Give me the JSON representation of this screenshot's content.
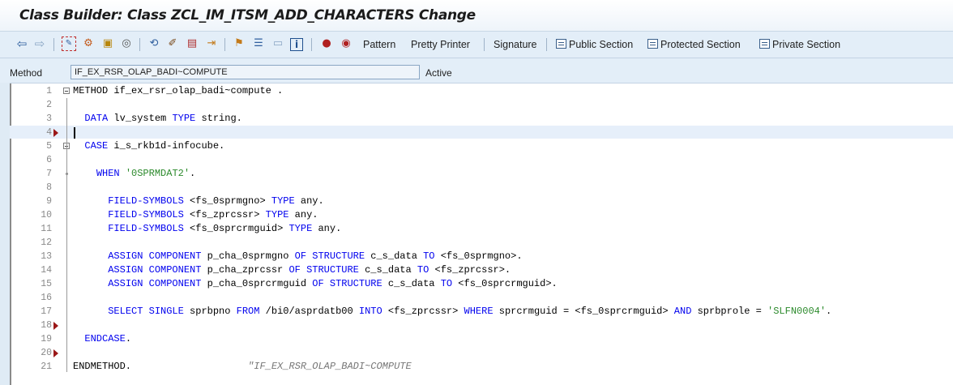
{
  "window": {
    "title": "Class Builder: Class ZCL_IM_ITSM_ADD_CHARACTERS Change"
  },
  "toolbar": {
    "icons": [
      "back-arrow-icon",
      "forward-arrow-icon",
      "display-change-icon",
      "other-object-icon",
      "activate-icon",
      "check-icon",
      "where-used-icon",
      "hierarchy-icon",
      "edit-icon",
      "display-object-list-icon",
      "navigate-icon",
      "tree-icon",
      "indent-icon",
      "frame-icon",
      "info-icon",
      "breakpoint-icon",
      "session-breakpoint-icon"
    ],
    "pattern": "Pattern",
    "pretty_printer": "Pretty Printer",
    "signature": "Signature",
    "public_section": "Public Section",
    "protected_section": "Protected Section",
    "private_section": "Private Section"
  },
  "method_row": {
    "label": "Method",
    "value": "IF_EX_RSR_OLAP_BADI~COMPUTE",
    "status": "Active"
  },
  "editor": {
    "lines": [
      {
        "num": "1",
        "breakpoint": false,
        "parts": [
          {
            "t": "METHOD",
            "c": ""
          },
          {
            "t": " if_ex_rsr_olap_badi~compute .",
            "c": ""
          }
        ]
      },
      {
        "num": "2",
        "breakpoint": false,
        "parts": []
      },
      {
        "num": "3",
        "breakpoint": false,
        "parts": [
          {
            "t": "  ",
            "c": ""
          },
          {
            "t": "DATA",
            "c": "kw"
          },
          {
            "t": " lv_system ",
            "c": ""
          },
          {
            "t": "TYPE",
            "c": "kw"
          },
          {
            "t": " string.",
            "c": ""
          }
        ]
      },
      {
        "num": "4",
        "breakpoint": true,
        "parts": []
      },
      {
        "num": "5",
        "breakpoint": false,
        "parts": [
          {
            "t": "  ",
            "c": ""
          },
          {
            "t": "CASE",
            "c": "kw"
          },
          {
            "t": " i_s_rkb1d-infocube.",
            "c": ""
          }
        ]
      },
      {
        "num": "6",
        "breakpoint": false,
        "parts": []
      },
      {
        "num": "7",
        "breakpoint": false,
        "parts": [
          {
            "t": "    ",
            "c": ""
          },
          {
            "t": "WHEN",
            "c": "kw"
          },
          {
            "t": " ",
            "c": ""
          },
          {
            "t": "'0SPRMDAT2'",
            "c": "str"
          },
          {
            "t": ".",
            "c": ""
          }
        ]
      },
      {
        "num": "8",
        "breakpoint": false,
        "parts": []
      },
      {
        "num": "9",
        "breakpoint": false,
        "parts": [
          {
            "t": "      ",
            "c": ""
          },
          {
            "t": "FIELD-SYMBOLS",
            "c": "kw"
          },
          {
            "t": " <fs_0sprmgno> ",
            "c": ""
          },
          {
            "t": "TYPE",
            "c": "kw"
          },
          {
            "t": " any.",
            "c": ""
          }
        ]
      },
      {
        "num": "10",
        "breakpoint": false,
        "parts": [
          {
            "t": "      ",
            "c": ""
          },
          {
            "t": "FIELD-SYMBOLS",
            "c": "kw"
          },
          {
            "t": " <fs_zprcssr> ",
            "c": ""
          },
          {
            "t": "TYPE",
            "c": "kw"
          },
          {
            "t": " any.",
            "c": ""
          }
        ]
      },
      {
        "num": "11",
        "breakpoint": false,
        "parts": [
          {
            "t": "      ",
            "c": ""
          },
          {
            "t": "FIELD-SYMBOLS",
            "c": "kw"
          },
          {
            "t": " <fs_0sprcrmguid> ",
            "c": ""
          },
          {
            "t": "TYPE",
            "c": "kw"
          },
          {
            "t": " any.",
            "c": ""
          }
        ]
      },
      {
        "num": "12",
        "breakpoint": false,
        "parts": []
      },
      {
        "num": "13",
        "breakpoint": false,
        "parts": [
          {
            "t": "      ",
            "c": ""
          },
          {
            "t": "ASSIGN COMPONENT",
            "c": "kw"
          },
          {
            "t": " p_cha_0sprmgno ",
            "c": ""
          },
          {
            "t": "OF STRUCTURE",
            "c": "kw"
          },
          {
            "t": " c_s_data ",
            "c": ""
          },
          {
            "t": "TO",
            "c": "kw"
          },
          {
            "t": " <fs_0sprmgno>.",
            "c": ""
          }
        ]
      },
      {
        "num": "14",
        "breakpoint": false,
        "parts": [
          {
            "t": "      ",
            "c": ""
          },
          {
            "t": "ASSIGN COMPONENT",
            "c": "kw"
          },
          {
            "t": " p_cha_zprcssr ",
            "c": ""
          },
          {
            "t": "OF STRUCTURE",
            "c": "kw"
          },
          {
            "t": " c_s_data ",
            "c": ""
          },
          {
            "t": "TO",
            "c": "kw"
          },
          {
            "t": " <fs_zprcssr>.",
            "c": ""
          }
        ]
      },
      {
        "num": "15",
        "breakpoint": false,
        "parts": [
          {
            "t": "      ",
            "c": ""
          },
          {
            "t": "ASSIGN COMPONENT",
            "c": "kw"
          },
          {
            "t": " p_cha_0sprcrmguid ",
            "c": ""
          },
          {
            "t": "OF STRUCTURE",
            "c": "kw"
          },
          {
            "t": " c_s_data ",
            "c": ""
          },
          {
            "t": "TO",
            "c": "kw"
          },
          {
            "t": " <fs_0sprcrmguid>.",
            "c": ""
          }
        ]
      },
      {
        "num": "16",
        "breakpoint": false,
        "parts": []
      },
      {
        "num": "17",
        "breakpoint": false,
        "parts": [
          {
            "t": "      ",
            "c": ""
          },
          {
            "t": "SELECT SINGLE",
            "c": "kw"
          },
          {
            "t": " sprbpno ",
            "c": ""
          },
          {
            "t": "FROM",
            "c": "kw"
          },
          {
            "t": " /bi0/asprdatb00 ",
            "c": ""
          },
          {
            "t": "INTO",
            "c": "kw"
          },
          {
            "t": " <fs_zprcssr> ",
            "c": ""
          },
          {
            "t": "WHERE",
            "c": "kw"
          },
          {
            "t": " sprcrmguid = <fs_0sprcrmguid> ",
            "c": ""
          },
          {
            "t": "AND",
            "c": "kw"
          },
          {
            "t": " sprbprole = ",
            "c": ""
          },
          {
            "t": "'SLFN0004'",
            "c": "str"
          },
          {
            "t": ".",
            "c": ""
          }
        ]
      },
      {
        "num": "18",
        "breakpoint": true,
        "parts": []
      },
      {
        "num": "19",
        "breakpoint": false,
        "parts": [
          {
            "t": "  ",
            "c": ""
          },
          {
            "t": "ENDCASE",
            "c": "kw"
          },
          {
            "t": ".",
            "c": ""
          }
        ]
      },
      {
        "num": "20",
        "breakpoint": true,
        "parts": []
      },
      {
        "num": "21",
        "breakpoint": false,
        "parts": [
          {
            "t": "ENDMETHOD.",
            "c": ""
          },
          {
            "t": "                    ",
            "c": ""
          },
          {
            "t": "\"IF_EX_RSR_OLAP_BADI~COMPUTE",
            "c": "cmt"
          }
        ]
      }
    ]
  },
  "colors": {
    "keyword": "#0000ee",
    "string": "#2c8a2c",
    "comment": "#777777",
    "breakpoint": "#9b1818"
  }
}
